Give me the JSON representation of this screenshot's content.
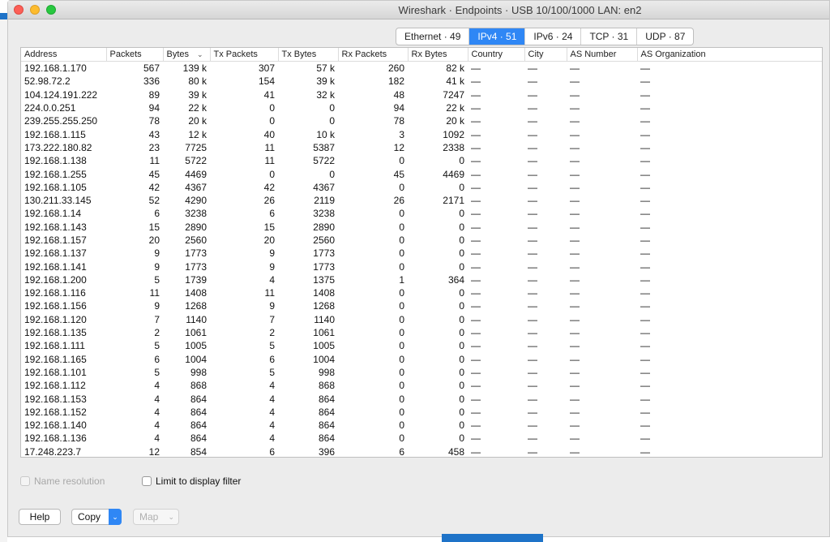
{
  "window": {
    "title": "Wireshark · Endpoints · USB 10/100/1000 LAN: en2"
  },
  "tabs": [
    {
      "label": "Ethernet · 49",
      "active": false
    },
    {
      "label": "IPv4 · 51",
      "active": true
    },
    {
      "label": "IPv6 · 24",
      "active": false
    },
    {
      "label": "TCP · 31",
      "active": false
    },
    {
      "label": "UDP · 87",
      "active": false
    }
  ],
  "table": {
    "columns": [
      "Address",
      "Packets",
      "Bytes",
      "Tx Packets",
      "Tx Bytes",
      "Rx Packets",
      "Rx Bytes",
      "Country",
      "City",
      "AS Number",
      "AS Organization"
    ],
    "sorted_column": "Bytes",
    "sort_indicator": "⌄",
    "empty_geo": "—",
    "rows": [
      [
        "192.168.1.170",
        "567",
        "139 k",
        "307",
        "57 k",
        "260",
        "82 k"
      ],
      [
        "52.98.72.2",
        "336",
        "80 k",
        "154",
        "39 k",
        "182",
        "41 k"
      ],
      [
        "104.124.191.222",
        "89",
        "39 k",
        "41",
        "32 k",
        "48",
        "7247"
      ],
      [
        "224.0.0.251",
        "94",
        "22 k",
        "0",
        "0",
        "94",
        "22 k"
      ],
      [
        "239.255.255.250",
        "78",
        "20 k",
        "0",
        "0",
        "78",
        "20 k"
      ],
      [
        "192.168.1.115",
        "43",
        "12 k",
        "40",
        "10 k",
        "3",
        "1092"
      ],
      [
        "173.222.180.82",
        "23",
        "7725",
        "11",
        "5387",
        "12",
        "2338"
      ],
      [
        "192.168.1.138",
        "11",
        "5722",
        "11",
        "5722",
        "0",
        "0"
      ],
      [
        "192.168.1.255",
        "45",
        "4469",
        "0",
        "0",
        "45",
        "4469"
      ],
      [
        "192.168.1.105",
        "42",
        "4367",
        "42",
        "4367",
        "0",
        "0"
      ],
      [
        "130.211.33.145",
        "52",
        "4290",
        "26",
        "2119",
        "26",
        "2171"
      ],
      [
        "192.168.1.14",
        "6",
        "3238",
        "6",
        "3238",
        "0",
        "0"
      ],
      [
        "192.168.1.143",
        "15",
        "2890",
        "15",
        "2890",
        "0",
        "0"
      ],
      [
        "192.168.1.157",
        "20",
        "2560",
        "20",
        "2560",
        "0",
        "0"
      ],
      [
        "192.168.1.137",
        "9",
        "1773",
        "9",
        "1773",
        "0",
        "0"
      ],
      [
        "192.168.1.141",
        "9",
        "1773",
        "9",
        "1773",
        "0",
        "0"
      ],
      [
        "192.168.1.200",
        "5",
        "1739",
        "4",
        "1375",
        "1",
        "364"
      ],
      [
        "192.168.1.116",
        "11",
        "1408",
        "11",
        "1408",
        "0",
        "0"
      ],
      [
        "192.168.1.156",
        "9",
        "1268",
        "9",
        "1268",
        "0",
        "0"
      ],
      [
        "192.168.1.120",
        "7",
        "1140",
        "7",
        "1140",
        "0",
        "0"
      ],
      [
        "192.168.1.135",
        "2",
        "1061",
        "2",
        "1061",
        "0",
        "0"
      ],
      [
        "192.168.1.111",
        "5",
        "1005",
        "5",
        "1005",
        "0",
        "0"
      ],
      [
        "192.168.1.165",
        "6",
        "1004",
        "6",
        "1004",
        "0",
        "0"
      ],
      [
        "192.168.1.101",
        "5",
        "998",
        "5",
        "998",
        "0",
        "0"
      ],
      [
        "192.168.1.112",
        "4",
        "868",
        "4",
        "868",
        "0",
        "0"
      ],
      [
        "192.168.1.153",
        "4",
        "864",
        "4",
        "864",
        "0",
        "0"
      ],
      [
        "192.168.1.152",
        "4",
        "864",
        "4",
        "864",
        "0",
        "0"
      ],
      [
        "192.168.1.140",
        "4",
        "864",
        "4",
        "864",
        "0",
        "0"
      ],
      [
        "192.168.1.136",
        "4",
        "864",
        "4",
        "864",
        "0",
        "0"
      ],
      [
        "17.248.223.7",
        "12",
        "854",
        "6",
        "396",
        "6",
        "458"
      ]
    ]
  },
  "options": {
    "name_resolution": {
      "label": "Name resolution",
      "checked": false,
      "enabled": false
    },
    "limit_filter": {
      "label": "Limit to display filter",
      "checked": false,
      "enabled": true
    }
  },
  "buttons": {
    "help": "Help",
    "copy": "Copy",
    "map": "Map"
  },
  "colors": {
    "accent": "#2f87f5",
    "close": "#fc5f57",
    "minimize": "#fdbc2e",
    "maximize": "#28c840"
  }
}
